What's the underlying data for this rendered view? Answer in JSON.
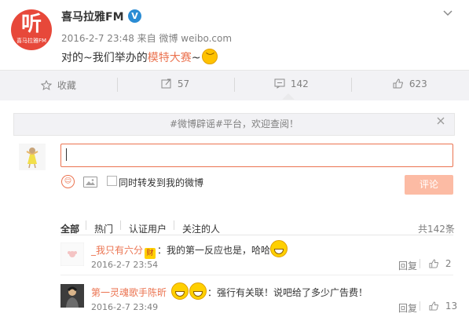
{
  "post": {
    "avatar_glyph": "听",
    "avatar_caption": "喜马拉雅FM",
    "author": "喜马拉雅FM",
    "verified_icon": "V",
    "meta": "2016-2-7 23:48 来自 微博 weibo.com",
    "text_prefix": "对的~我们举办的",
    "text_highlight": "模特大赛",
    "text_suffix": "~",
    "highlight_color": "#eb7350"
  },
  "actions": {
    "favorite": "收藏",
    "repost_count": "57",
    "comment_count": "142",
    "like_count": "623"
  },
  "comment_box": {
    "notice": "#微博辟谣#平台，欢迎查阅！",
    "repost_label": "同时转发到我的微博",
    "submit_label": "评论"
  },
  "filters": {
    "all": "全部",
    "hot": "热门",
    "verified": "认证用户",
    "following": "关注的人",
    "total": "共142条"
  },
  "comments": [
    {
      "name": "_我只有六分",
      "badge": "财",
      "text": "：我的第一反应也是，哈哈",
      "time": "2016-2-7 23:54",
      "reply_label": "回复",
      "likes": "2"
    },
    {
      "name": "第一灵魂歌手陈昕",
      "text": "：强行有关联！说吧给了多少广告费！",
      "time": "2016-2-7 23:49",
      "reply_label": "回复",
      "likes": "13"
    }
  ]
}
